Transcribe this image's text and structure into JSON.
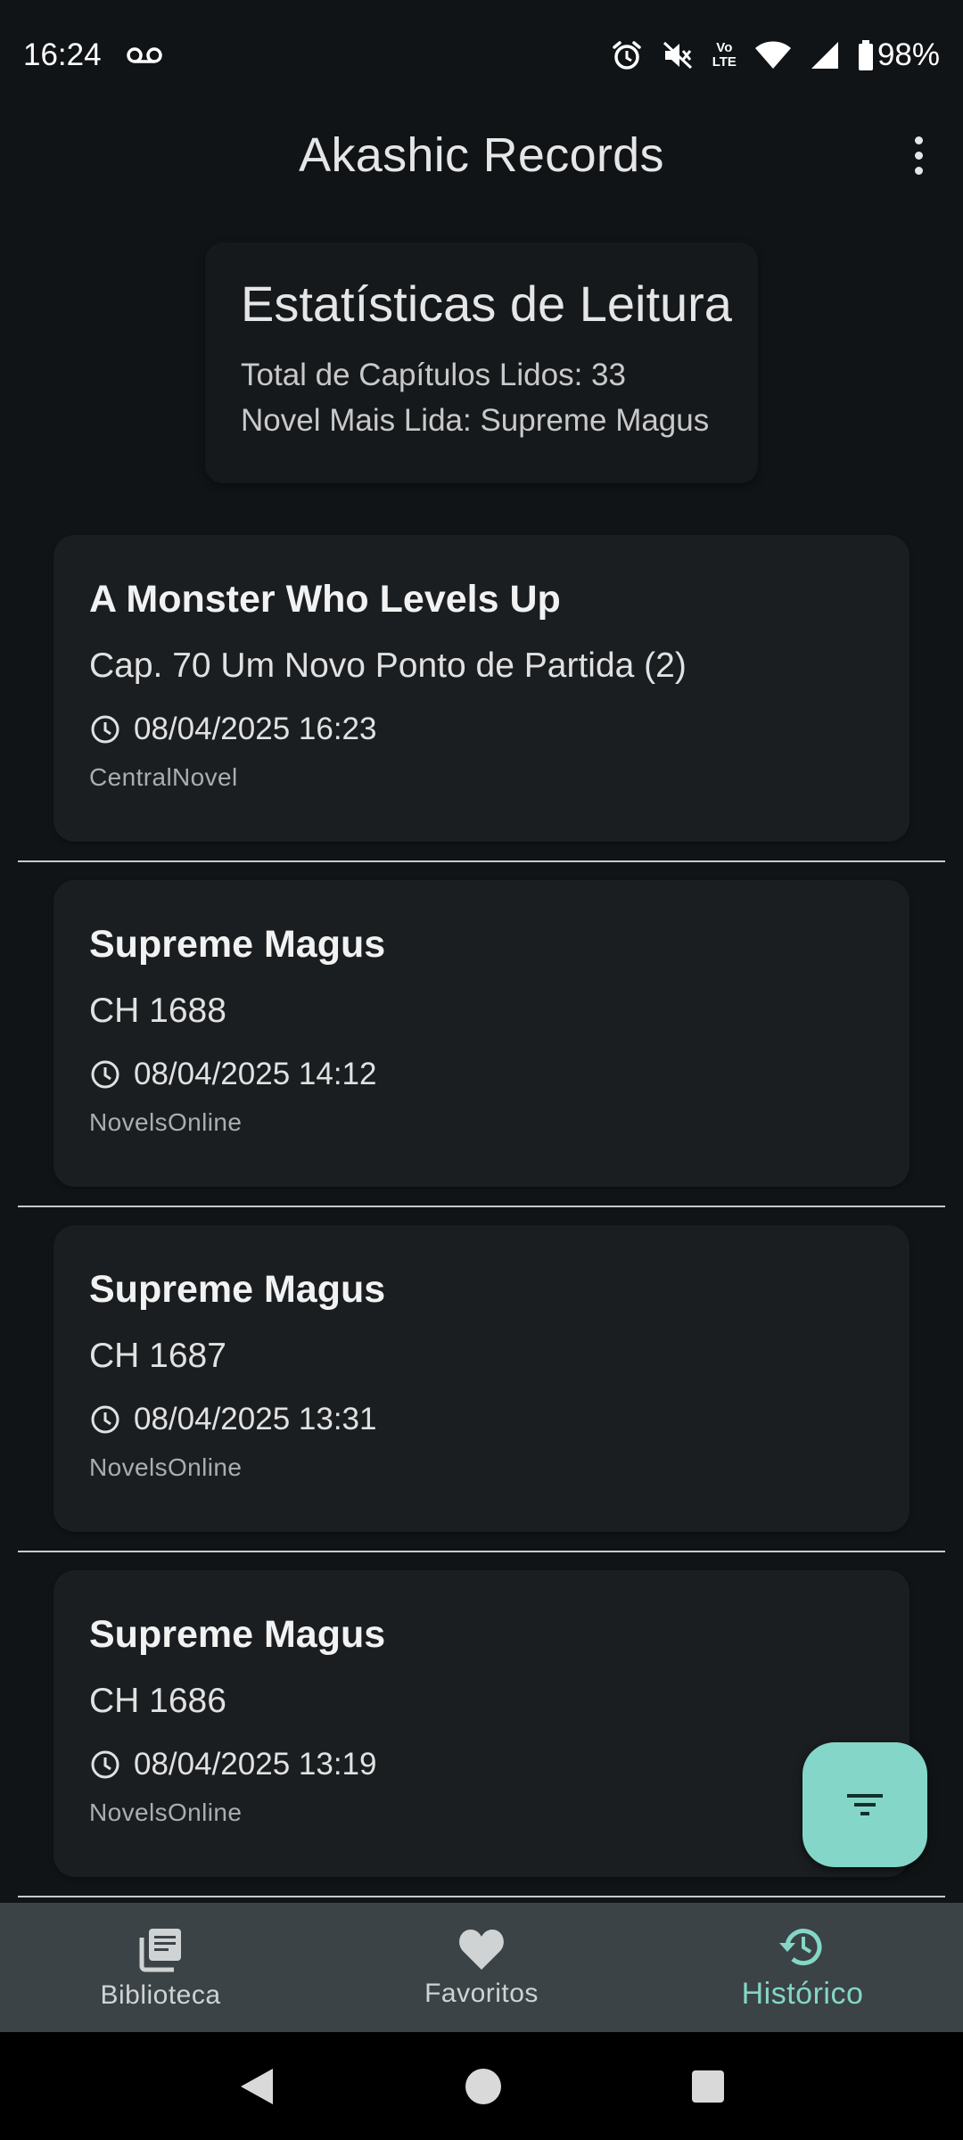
{
  "status_bar": {
    "time": "16:24",
    "battery": "98%",
    "network_badge": [
      "Vo",
      "LTE"
    ],
    "icons": [
      "voicemail-icon",
      "alarm-icon",
      "vibrate-off-icon",
      "volte-icon",
      "wifi-icon",
      "signal-icon",
      "battery-icon"
    ]
  },
  "app_bar": {
    "title": "Akashic Records",
    "menu_icon": "more-vert-icon"
  },
  "stats": {
    "title": "Estatísticas de Leitura",
    "total_chapters": "Total de Capítulos Lidos: 33",
    "most_read": "Novel Mais Lida: Supreme Magus"
  },
  "history": [
    {
      "title": "A Monster Who Levels Up",
      "chapter": "Cap. 70 Um Novo Ponto de Partida (2)",
      "datetime": "08/04/2025 16:23",
      "source": "CentralNovel"
    },
    {
      "title": "Supreme Magus",
      "chapter": "CH 1688",
      "datetime": "08/04/2025 14:12",
      "source": "NovelsOnline"
    },
    {
      "title": "Supreme Magus",
      "chapter": "CH 1687",
      "datetime": "08/04/2025 13:31",
      "source": "NovelsOnline"
    },
    {
      "title": "Supreme Magus",
      "chapter": "CH 1686",
      "datetime": "08/04/2025 13:19",
      "source": "NovelsOnline"
    }
  ],
  "fab": {
    "icon": "filter-icon"
  },
  "bottom_nav": [
    {
      "label": "Biblioteca",
      "icon": "library-icon",
      "active": false
    },
    {
      "label": "Favoritos",
      "icon": "heart-icon",
      "active": false
    },
    {
      "label": "Histórico",
      "icon": "history-icon",
      "active": true
    }
  ],
  "colors": {
    "background": "#111416",
    "card": "#1a1e20",
    "accent": "#84d7c8",
    "bottom_nav": "#3b4346"
  }
}
